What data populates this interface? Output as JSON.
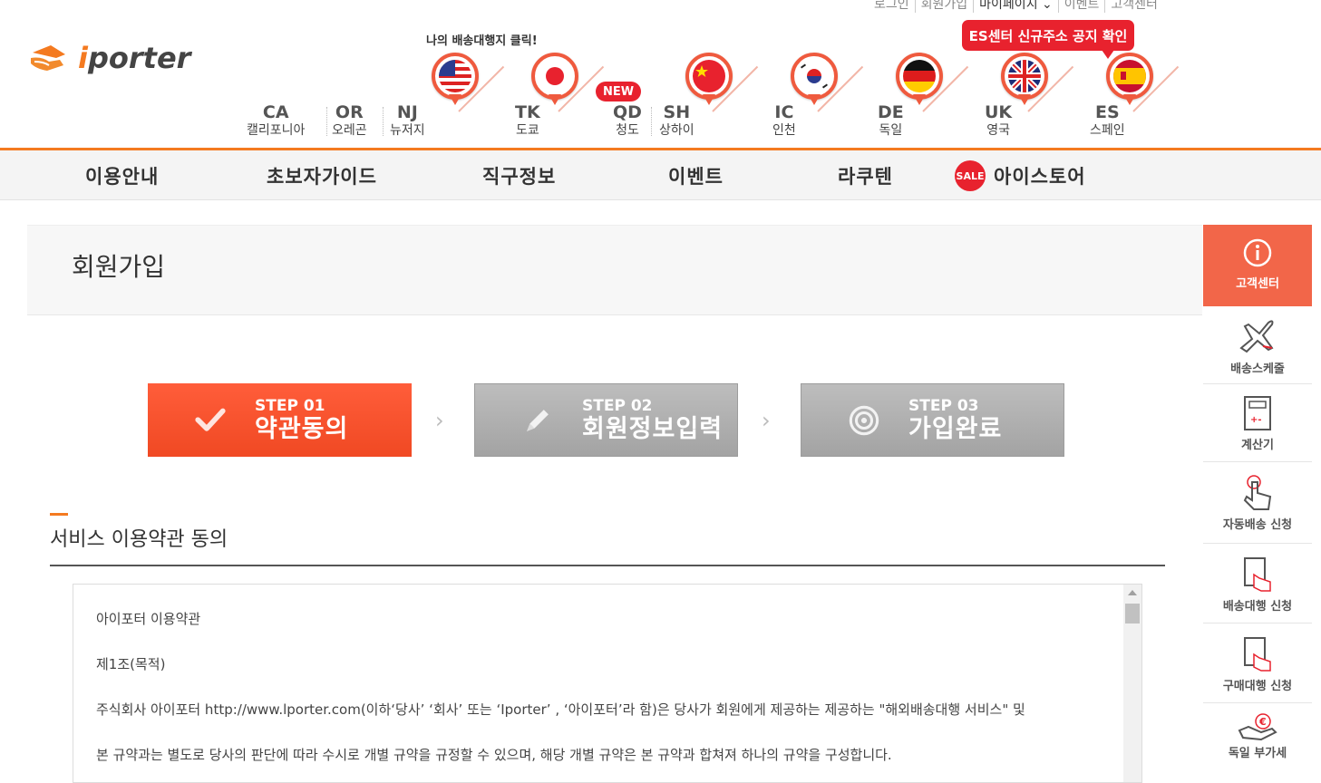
{
  "util_links": [
    "로그인",
    "회원가입",
    "마이페이지 ⌄",
    "이벤트",
    "고객센터"
  ],
  "logo": {
    "i": "i",
    "rest": "porter"
  },
  "pin_hint": "나의 배송대행지 클릭!",
  "es_notice": "ES센터 신규주소 공지 확인",
  "new_badge": "NEW",
  "countries": [
    {
      "code": "CA",
      "name": "캘리포니아"
    },
    {
      "code": "OR",
      "name": "오레곤"
    },
    {
      "code": "NJ",
      "name": "뉴저지"
    },
    {
      "code": "TK",
      "name": "도쿄"
    },
    {
      "code": "QD",
      "name": "청도"
    },
    {
      "code": "SH",
      "name": "상하이"
    },
    {
      "code": "IC",
      "name": "인천"
    },
    {
      "code": "DE",
      "name": "독일"
    },
    {
      "code": "UK",
      "name": "영국"
    },
    {
      "code": "ES",
      "name": "스페인"
    }
  ],
  "nav": [
    "이용안내",
    "초보자가이드",
    "직구정보",
    "이벤트",
    "라쿠텐",
    "아이스토어"
  ],
  "sale_icon": "SALE",
  "page_title": "회원가입",
  "steps": [
    {
      "num": "STEP 01",
      "label": "약관동의",
      "active": true
    },
    {
      "num": "STEP 02",
      "label": "회원정보입력",
      "active": false
    },
    {
      "num": "STEP 03",
      "label": "가입완료",
      "active": false
    }
  ],
  "terms_heading": "서비스 이용약관 동의",
  "terms_lines": [
    "아이포터 이용약관",
    "제1조(목적)",
    "주식회사 아이포터 http://www.lporter.com(이하‘당사’ ‘회사’ 또는 ‘Iporter’ , ‘아이포터’라 함)은 당사가 회원에게 제공하는 제공하는 \"해외배송대행 서비스\" 및",
    "본 규약과는 별도로 당사의 판단에 따라 수시로 개별 규약을 규정할 수 있으며, 해당 개별 규약은 본 규약과 합쳐져 하나의 규약을 구성합니다."
  ],
  "quick_menu": [
    "고객센터",
    "배송스케줄",
    "계산기",
    "자동배송 신청",
    "배송대행 신청",
    "구매대행 신청",
    "독일 부가세"
  ],
  "colors": {
    "accent": "#f47a20",
    "step_active": "#f04923",
    "quick_header": "#f26649",
    "notice": "#e8222e"
  }
}
